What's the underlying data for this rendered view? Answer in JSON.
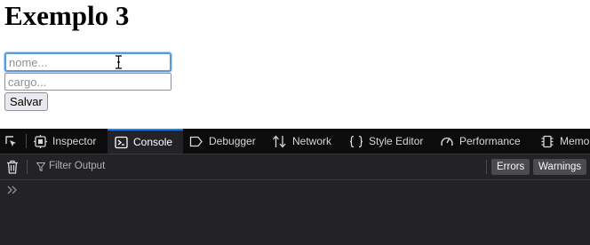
{
  "page": {
    "title": "Exemplo 3",
    "name_field": {
      "placeholder": "nome...",
      "value": ""
    },
    "role_field": {
      "placeholder": "cargo...",
      "value": ""
    },
    "save_button": "Salvar"
  },
  "devtools": {
    "tabs": [
      {
        "label": "Inspector",
        "icon": "inspector-icon",
        "active": false
      },
      {
        "label": "Console",
        "icon": "console-icon",
        "active": true
      },
      {
        "label": "Debugger",
        "icon": "debugger-icon",
        "active": false
      },
      {
        "label": "Network",
        "icon": "network-icon",
        "active": false
      },
      {
        "label": "Style Editor",
        "icon": "style-editor-icon",
        "active": false
      },
      {
        "label": "Performance",
        "icon": "performance-icon",
        "active": false
      },
      {
        "label": "Memo",
        "icon": "memory-icon",
        "active": false
      }
    ],
    "toolbar": {
      "filter_placeholder": "Filter Output",
      "errors_label": "Errors",
      "warnings_label": "Warnings"
    },
    "colors": {
      "accent": "#0a84ff",
      "tabbar_bg": "#0c0c0d",
      "panel_bg": "#232327"
    }
  }
}
